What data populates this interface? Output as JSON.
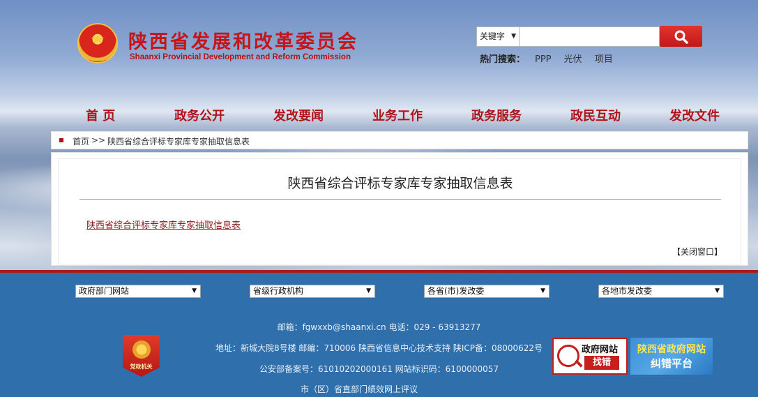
{
  "header": {
    "title": "陕西省发展和改革委员会",
    "subtitle": "Shaanxi Provincial Development and Reform Commission"
  },
  "search": {
    "type_label": "关键字",
    "input_value": "",
    "hot_label": "热门搜索：",
    "hot_terms": [
      "PPP",
      "光伏",
      "项目"
    ]
  },
  "nav": {
    "items": [
      "首 页",
      "政务公开",
      "发改要闻",
      "业务工作",
      "政务服务",
      "政民互动",
      "发改文件"
    ]
  },
  "breadcrumb": {
    "home": "首页",
    "separator": ">>",
    "current": "陕西省综合评标专家库专家抽取信息表"
  },
  "article": {
    "title": "陕西省综合评标专家库专家抽取信息表",
    "link_text": "陕西省综合评标专家库专家抽取信息表",
    "close_label": "【关闭窗口】"
  },
  "footer": {
    "selects": [
      "政府部门网站",
      "省级行政机构",
      "各省(市)发改委",
      "各地市发改委"
    ],
    "contact_line": "邮箱：fgwxxb@shaanxi.cn   电话：029 - 63913277",
    "address_line": "地址：新城大院8号楼   邮编：710006   陕西省信息中心技术支持   陕ICP备：08000622号",
    "record_line": "公安部备案号：61010202000161   网站标识码：6100000057",
    "eval_line": "市（区）省直部门绩效网上评议",
    "party_badge_text": "党政机关",
    "gov_badge_title": "政府网站",
    "gov_badge_action": "找错",
    "platform_line1": "陕西省政府网站",
    "platform_line2": "纠错平台"
  },
  "colors": {
    "brand_red": "#c5151b",
    "footer_blue": "#2e6fac"
  }
}
